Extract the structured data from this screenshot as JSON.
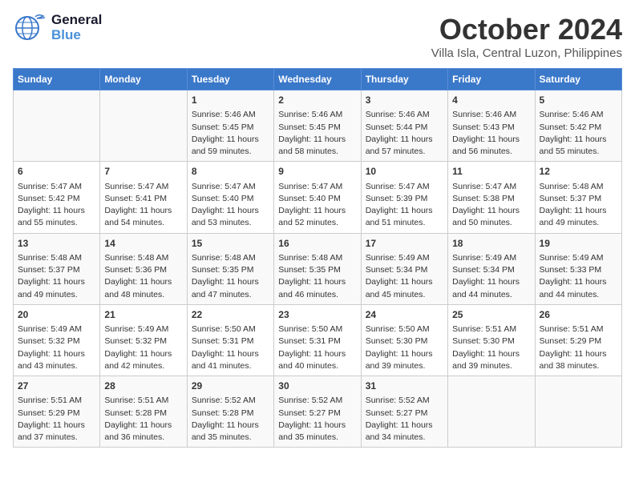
{
  "header": {
    "logo_general": "General",
    "logo_blue": "Blue",
    "month": "October 2024",
    "location": "Villa Isla, Central Luzon, Philippines"
  },
  "days_of_week": [
    "Sunday",
    "Monday",
    "Tuesday",
    "Wednesday",
    "Thursday",
    "Friday",
    "Saturday"
  ],
  "weeks": [
    [
      {
        "day": "",
        "content": ""
      },
      {
        "day": "",
        "content": ""
      },
      {
        "day": "1",
        "content": "Sunrise: 5:46 AM\nSunset: 5:45 PM\nDaylight: 11 hours and 59 minutes."
      },
      {
        "day": "2",
        "content": "Sunrise: 5:46 AM\nSunset: 5:45 PM\nDaylight: 11 hours and 58 minutes."
      },
      {
        "day": "3",
        "content": "Sunrise: 5:46 AM\nSunset: 5:44 PM\nDaylight: 11 hours and 57 minutes."
      },
      {
        "day": "4",
        "content": "Sunrise: 5:46 AM\nSunset: 5:43 PM\nDaylight: 11 hours and 56 minutes."
      },
      {
        "day": "5",
        "content": "Sunrise: 5:46 AM\nSunset: 5:42 PM\nDaylight: 11 hours and 55 minutes."
      }
    ],
    [
      {
        "day": "6",
        "content": "Sunrise: 5:47 AM\nSunset: 5:42 PM\nDaylight: 11 hours and 55 minutes."
      },
      {
        "day": "7",
        "content": "Sunrise: 5:47 AM\nSunset: 5:41 PM\nDaylight: 11 hours and 54 minutes."
      },
      {
        "day": "8",
        "content": "Sunrise: 5:47 AM\nSunset: 5:40 PM\nDaylight: 11 hours and 53 minutes."
      },
      {
        "day": "9",
        "content": "Sunrise: 5:47 AM\nSunset: 5:40 PM\nDaylight: 11 hours and 52 minutes."
      },
      {
        "day": "10",
        "content": "Sunrise: 5:47 AM\nSunset: 5:39 PM\nDaylight: 11 hours and 51 minutes."
      },
      {
        "day": "11",
        "content": "Sunrise: 5:47 AM\nSunset: 5:38 PM\nDaylight: 11 hours and 50 minutes."
      },
      {
        "day": "12",
        "content": "Sunrise: 5:48 AM\nSunset: 5:37 PM\nDaylight: 11 hours and 49 minutes."
      }
    ],
    [
      {
        "day": "13",
        "content": "Sunrise: 5:48 AM\nSunset: 5:37 PM\nDaylight: 11 hours and 49 minutes."
      },
      {
        "day": "14",
        "content": "Sunrise: 5:48 AM\nSunset: 5:36 PM\nDaylight: 11 hours and 48 minutes."
      },
      {
        "day": "15",
        "content": "Sunrise: 5:48 AM\nSunset: 5:35 PM\nDaylight: 11 hours and 47 minutes."
      },
      {
        "day": "16",
        "content": "Sunrise: 5:48 AM\nSunset: 5:35 PM\nDaylight: 11 hours and 46 minutes."
      },
      {
        "day": "17",
        "content": "Sunrise: 5:49 AM\nSunset: 5:34 PM\nDaylight: 11 hours and 45 minutes."
      },
      {
        "day": "18",
        "content": "Sunrise: 5:49 AM\nSunset: 5:34 PM\nDaylight: 11 hours and 44 minutes."
      },
      {
        "day": "19",
        "content": "Sunrise: 5:49 AM\nSunset: 5:33 PM\nDaylight: 11 hours and 44 minutes."
      }
    ],
    [
      {
        "day": "20",
        "content": "Sunrise: 5:49 AM\nSunset: 5:32 PM\nDaylight: 11 hours and 43 minutes."
      },
      {
        "day": "21",
        "content": "Sunrise: 5:49 AM\nSunset: 5:32 PM\nDaylight: 11 hours and 42 minutes."
      },
      {
        "day": "22",
        "content": "Sunrise: 5:50 AM\nSunset: 5:31 PM\nDaylight: 11 hours and 41 minutes."
      },
      {
        "day": "23",
        "content": "Sunrise: 5:50 AM\nSunset: 5:31 PM\nDaylight: 11 hours and 40 minutes."
      },
      {
        "day": "24",
        "content": "Sunrise: 5:50 AM\nSunset: 5:30 PM\nDaylight: 11 hours and 39 minutes."
      },
      {
        "day": "25",
        "content": "Sunrise: 5:51 AM\nSunset: 5:30 PM\nDaylight: 11 hours and 39 minutes."
      },
      {
        "day": "26",
        "content": "Sunrise: 5:51 AM\nSunset: 5:29 PM\nDaylight: 11 hours and 38 minutes."
      }
    ],
    [
      {
        "day": "27",
        "content": "Sunrise: 5:51 AM\nSunset: 5:29 PM\nDaylight: 11 hours and 37 minutes."
      },
      {
        "day": "28",
        "content": "Sunrise: 5:51 AM\nSunset: 5:28 PM\nDaylight: 11 hours and 36 minutes."
      },
      {
        "day": "29",
        "content": "Sunrise: 5:52 AM\nSunset: 5:28 PM\nDaylight: 11 hours and 35 minutes."
      },
      {
        "day": "30",
        "content": "Sunrise: 5:52 AM\nSunset: 5:27 PM\nDaylight: 11 hours and 35 minutes."
      },
      {
        "day": "31",
        "content": "Sunrise: 5:52 AM\nSunset: 5:27 PM\nDaylight: 11 hours and 34 minutes."
      },
      {
        "day": "",
        "content": ""
      },
      {
        "day": "",
        "content": ""
      }
    ]
  ]
}
